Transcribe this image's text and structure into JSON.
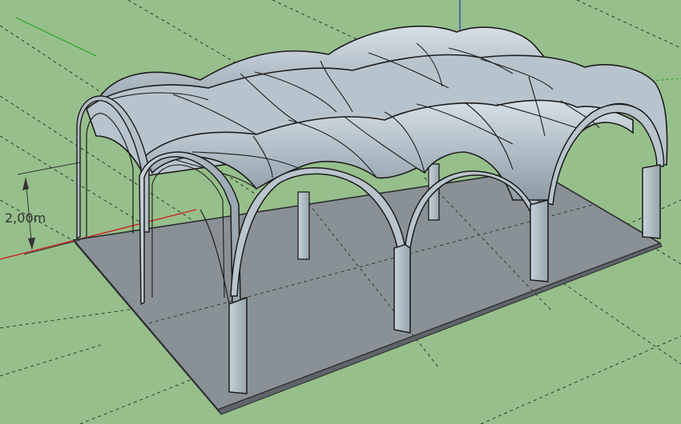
{
  "viewport": {
    "background": "#97bf8b"
  },
  "dimension": {
    "label": "2,00m"
  },
  "colors": {
    "floor": "#8a9196",
    "floor_edge": "#3a3d40",
    "vault_light": "#c9d4dc",
    "vault_mid": "#a9b6c0",
    "vault_dark": "#7f8c96",
    "column": "#b7c3cc",
    "axis_red": "#cc2222",
    "axis_green": "#1fa01f",
    "axis_blue": "#2233cc"
  }
}
